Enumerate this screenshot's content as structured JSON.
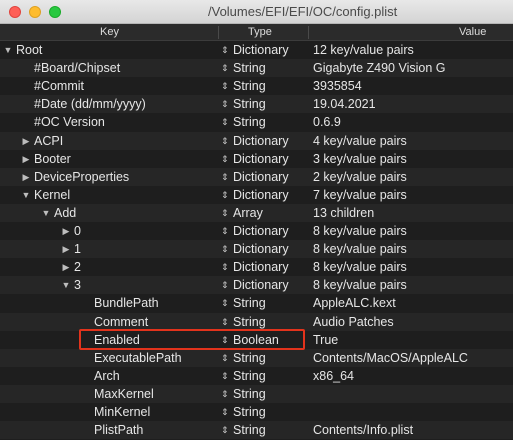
{
  "window": {
    "title": "/Volumes/EFI/EFI/OC/config.plist"
  },
  "columns": {
    "key": "Key",
    "type": "Type",
    "value": "Value"
  },
  "rows": [
    {
      "key": "Root",
      "type": "Dictionary",
      "value": "12 key/value pairs",
      "arrow": "▼"
    },
    {
      "key": "#Board/Chipset",
      "type": "String",
      "value": "Gigabyte Z490 Vision G",
      "arrow": ""
    },
    {
      "key": "#Commit",
      "type": "String",
      "value": "3935854",
      "arrow": ""
    },
    {
      "key": "#Date (dd/mm/yyyy)",
      "type": "String",
      "value": "19.04.2021",
      "arrow": ""
    },
    {
      "key": "#OC Version",
      "type": "String",
      "value": "0.6.9",
      "arrow": ""
    },
    {
      "key": "ACPI",
      "type": "Dictionary",
      "value": "4 key/value pairs",
      "arrow": "▶"
    },
    {
      "key": "Booter",
      "type": "Dictionary",
      "value": "3 key/value pairs",
      "arrow": "▶"
    },
    {
      "key": "DeviceProperties",
      "type": "Dictionary",
      "value": "2 key/value pairs",
      "arrow": "▶"
    },
    {
      "key": "Kernel",
      "type": "Dictionary",
      "value": "7 key/value pairs",
      "arrow": "▼"
    },
    {
      "key": "Add",
      "type": "Array",
      "value": "13 children",
      "arrow": "▼"
    },
    {
      "key": "0",
      "type": "Dictionary",
      "value": "8 key/value pairs",
      "arrow": "▶"
    },
    {
      "key": "1",
      "type": "Dictionary",
      "value": "8 key/value pairs",
      "arrow": "▶"
    },
    {
      "key": "2",
      "type": "Dictionary",
      "value": "8 key/value pairs",
      "arrow": "▶"
    },
    {
      "key": "3",
      "type": "Dictionary",
      "value": "8 key/value pairs",
      "arrow": "▼"
    },
    {
      "key": "BundlePath",
      "type": "String",
      "value": "AppleALC.kext",
      "arrow": ""
    },
    {
      "key": "Comment",
      "type": "String",
      "value": "Audio Patches",
      "arrow": ""
    },
    {
      "key": "Enabled",
      "type": "Boolean",
      "value": "True",
      "arrow": ""
    },
    {
      "key": "ExecutablePath",
      "type": "String",
      "value": "Contents/MacOS/AppleALC",
      "arrow": ""
    },
    {
      "key": "Arch",
      "type": "String",
      "value": "x86_64",
      "arrow": ""
    },
    {
      "key": "MaxKernel",
      "type": "String",
      "value": "",
      "arrow": ""
    },
    {
      "key": "MinKernel",
      "type": "String",
      "value": "",
      "arrow": ""
    },
    {
      "key": "PlistPath",
      "type": "String",
      "value": "Contents/Info.plist",
      "arrow": ""
    }
  ],
  "stepper_glyph": "⇕",
  "highlight_color": "#e2331c"
}
